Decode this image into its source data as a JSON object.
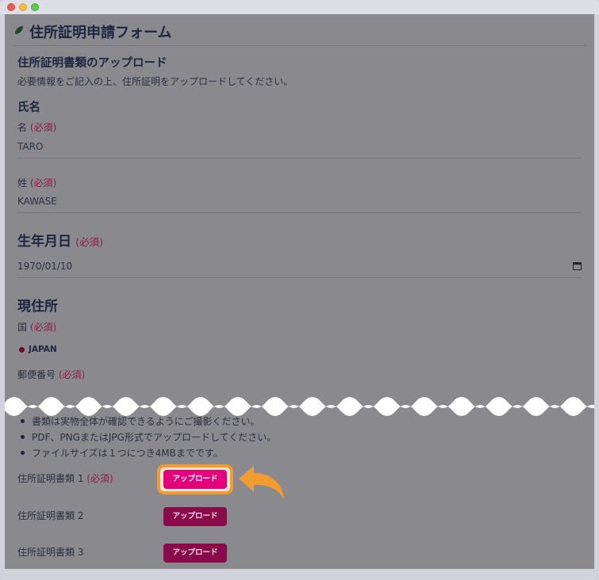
{
  "form": {
    "title": "住所証明申請フォーム",
    "upload_section_title": "住所証明書類のアップロード",
    "intro": "必要情報をご記入の上、住所証明をアップロードしてください。",
    "required_tag": "(必須)",
    "name_section": "氏名",
    "first_name_label": "名",
    "first_name_value": "TARO",
    "last_name_label": "姓",
    "last_name_value": "KAWASE",
    "dob_section": "生年月日",
    "dob_value": "1970/01/10",
    "address_section": "現住所",
    "country_label": "国",
    "country_value": "JAPAN",
    "postal_label": "郵便番号"
  },
  "instructions": [
    "書類は実物全体が確認できるようにご撮影ください。",
    "PDF、PNGまたはJPG形式でアップロードしてください。",
    "ファイルサイズは１つにつき4MBまでです。"
  ],
  "documents": [
    {
      "label": "住所証明書類 1",
      "required": "(必須)",
      "button": "アップロード"
    },
    {
      "label": "住所証明書類 2",
      "button": "アップロード"
    },
    {
      "label": "住所証明書類 3",
      "button": "アップロード"
    }
  ],
  "colors": {
    "accent": "#e3007a",
    "required": "#8e1a48",
    "highlight": "#f29b2f"
  },
  "icons": [
    "leaf-icon",
    "calendar-icon",
    "flag-icon",
    "pointer-arrow-icon"
  ]
}
